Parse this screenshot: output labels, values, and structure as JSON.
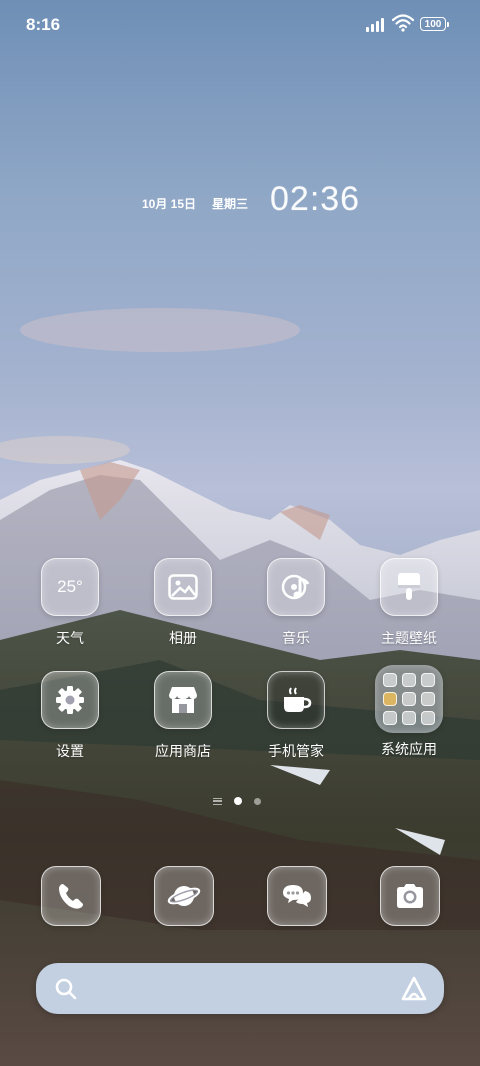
{
  "status_bar": {
    "time": "8:16",
    "battery": "100"
  },
  "clock_widget": {
    "date": "10月 15日",
    "weekday": "星期三",
    "time": "02:36"
  },
  "apps": [
    {
      "label": "天气",
      "icon": "weather-icon",
      "icon_text": "25°"
    },
    {
      "label": "相册",
      "icon": "gallery-icon"
    },
    {
      "label": "音乐",
      "icon": "music-icon"
    },
    {
      "label": "主题壁纸",
      "icon": "theme-brush-icon"
    },
    {
      "label": "设置",
      "icon": "settings-gear-icon"
    },
    {
      "label": "应用商店",
      "icon": "store-icon"
    },
    {
      "label": "手机管家",
      "icon": "security-cup-icon"
    },
    {
      "label": "系统应用",
      "icon": "folder-icon"
    }
  ],
  "page_indicator": {
    "pages": 2,
    "active": 1
  },
  "dock": [
    {
      "icon": "phone-icon"
    },
    {
      "icon": "browser-planet-icon"
    },
    {
      "icon": "messages-icon"
    },
    {
      "icon": "camera-icon"
    }
  ],
  "search_bar": {
    "placeholder": ""
  }
}
